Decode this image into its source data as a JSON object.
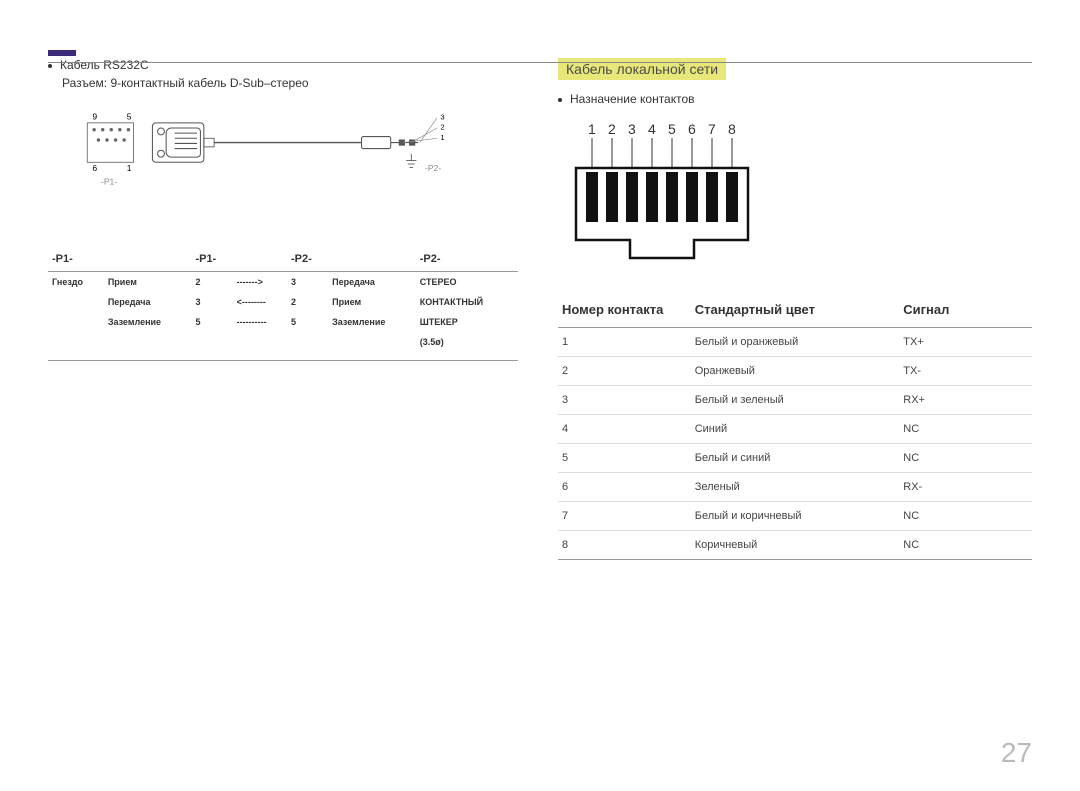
{
  "left": {
    "bullet": "Кабель RS232C",
    "subline": "Разъем: 9-контактный кабель D-Sub–стерео",
    "p1_label": "-P1-",
    "p2_label": "-P2-",
    "pin_numbers_left": {
      "tl": "9",
      "tr": "5",
      "bl": "6",
      "br": "1"
    },
    "stereo_pins": {
      "a": "3",
      "b": "2",
      "c": "1"
    },
    "table": {
      "headers": [
        "-P1-",
        "-P1-",
        "-P2-",
        "-P2-"
      ],
      "rows": [
        [
          "Гнездо",
          "Прием",
          "2",
          "------->",
          "3",
          "Передача",
          "СТЕРЕО"
        ],
        [
          "",
          "Передача",
          "3",
          "<--------",
          "2",
          "Прием",
          "КОНТАКТНЫЙ"
        ],
        [
          "",
          "Заземление",
          "5",
          "----------",
          "5",
          "Заземление",
          "ШТЕКЕР"
        ],
        [
          "",
          "",
          "",
          "",
          "",
          "",
          "(3.5ø)"
        ]
      ]
    }
  },
  "right": {
    "title": "Кабель локальной сети",
    "bullet": "Назначение контактов",
    "rj45_pins": [
      "1",
      "2",
      "3",
      "4",
      "5",
      "6",
      "7",
      "8"
    ],
    "table": {
      "headers": [
        "Номер контакта",
        "Стандартный цвет",
        "Сигнал"
      ],
      "rows": [
        [
          "1",
          "Белый и оранжевый",
          "TX+"
        ],
        [
          "2",
          "Оранжевый",
          "TX-"
        ],
        [
          "3",
          "Белый и зеленый",
          "RX+"
        ],
        [
          "4",
          "Синий",
          "NC"
        ],
        [
          "5",
          "Белый и синий",
          "NC"
        ],
        [
          "6",
          "Зеленый",
          "RX-"
        ],
        [
          "7",
          "Белый и коричневый",
          "NC"
        ],
        [
          "8",
          "Коричневый",
          "NC"
        ]
      ]
    }
  },
  "page_number": "27"
}
